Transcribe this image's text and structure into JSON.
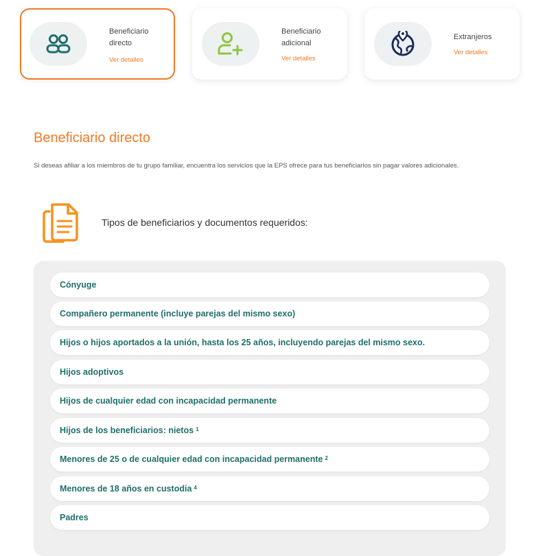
{
  "cards": [
    {
      "title": "Beneficiario directo",
      "link": "Ver detalles",
      "icon": "people-icon"
    },
    {
      "title": "Beneficiario adicional",
      "link": "Ver detalles",
      "icon": "add-user-icon"
    },
    {
      "title": "Extranjeros",
      "link": "Ver detalles",
      "icon": "globe-location-icon"
    }
  ],
  "section": {
    "title": "Beneficiario directo",
    "description": "Si deseas afiliar a los miembros de tu grupo familiar, encuentra los servicios que la EPS ofrece para tus beneficiarios sin pagar valores adicionales.",
    "requirements_title": "Tipos de beneficiarios y documentos requeridos:"
  },
  "beneficiary_types": [
    {
      "label": "Cónyuge",
      "note": ""
    },
    {
      "label": "Compañero permanente (incluye parejas del mismo sexo)",
      "note": ""
    },
    {
      "label": "Hijos o hijos aportados a la unión, hasta los 25 años, incluyendo parejas del mismo sexo.",
      "note": ""
    },
    {
      "label": "Hijos adoptivos",
      "note": ""
    },
    {
      "label": "Hijos de cualquier edad con incapacidad permanente",
      "note": ""
    },
    {
      "label": "Hijos de los beneficiarios: nietos",
      "note": "1"
    },
    {
      "label": "Menores de 25 o de cualquier edad con incapacidad permanente",
      "note": "2"
    },
    {
      "label": "Menores de 18 años en custodia",
      "note": "4"
    },
    {
      "label": "Padres",
      "note": ""
    }
  ],
  "colors": {
    "accent": "#f07a24",
    "teal": "#1f6f6a",
    "green": "#8cc63f",
    "navy": "#1c2a5a"
  }
}
